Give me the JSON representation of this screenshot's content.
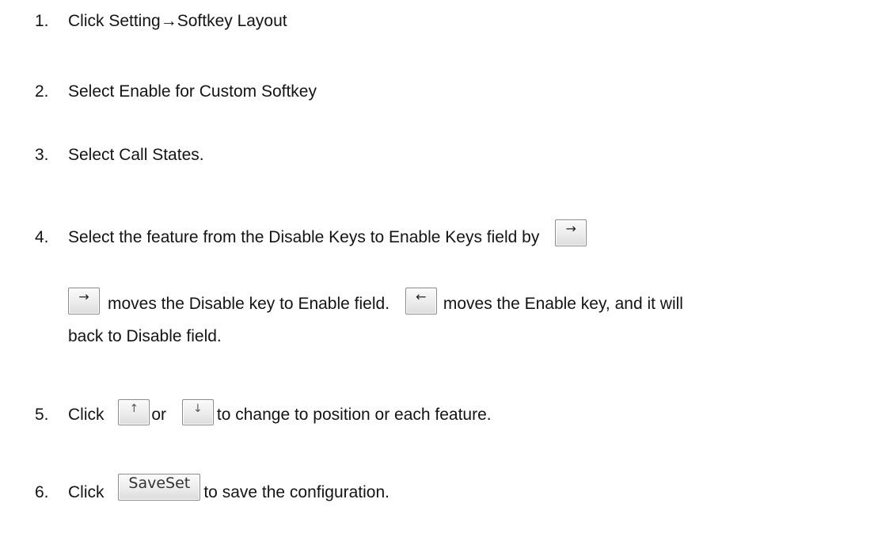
{
  "steps": {
    "s1": {
      "num": "1.",
      "text": "Click Setting→Softkey Layout"
    },
    "s2": {
      "num": "2.",
      "text": "Select Enable for Custom Softkey"
    },
    "s3": {
      "num": "3.",
      "text": "Select Call States."
    },
    "s4": {
      "num": "4.",
      "text": "Select the feature from the Disable Keys to Enable Keys field by",
      "button": "→",
      "line2_text_a": "moves the Disable key to Enable field.",
      "line2_button_b": "←",
      "line2_text_b": "moves the Enable key, and it  will",
      "line3": "back to Disable field.",
      "line2_button_a": "→"
    },
    "s5": {
      "num": "5.",
      "text_a": "Click",
      "button_up": "↑",
      "text_or": "or",
      "button_down": "↓",
      "text_b": "to change to position or each feature."
    },
    "s6": {
      "num": "6.",
      "text_a": "Click",
      "button": "SaveSet",
      "text_b": "to save the configuration."
    }
  },
  "icons": [
    "right-arrow-icon",
    "left-arrow-icon",
    "up-arrow-icon",
    "down-arrow-icon"
  ]
}
